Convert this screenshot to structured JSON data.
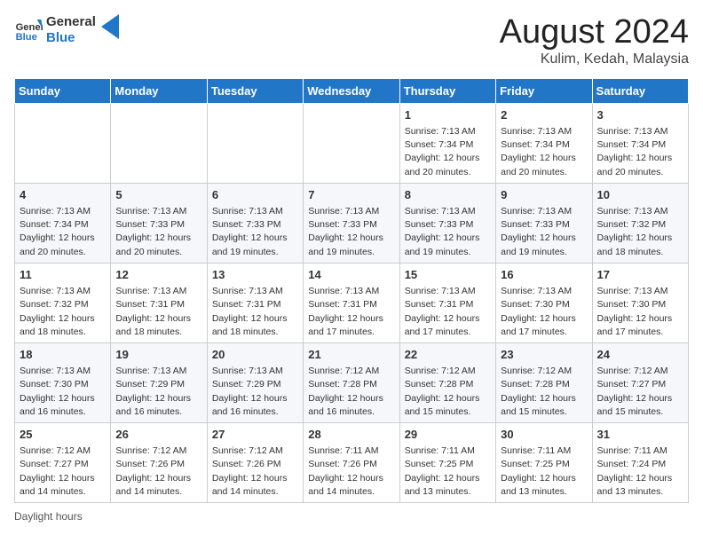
{
  "header": {
    "logo_line1": "General",
    "logo_line2": "Blue",
    "main_title": "August 2024",
    "subtitle": "Kulim, Kedah, Malaysia"
  },
  "columns": [
    "Sunday",
    "Monday",
    "Tuesday",
    "Wednesday",
    "Thursday",
    "Friday",
    "Saturday"
  ],
  "weeks": [
    [
      {
        "day": "",
        "info": ""
      },
      {
        "day": "",
        "info": ""
      },
      {
        "day": "",
        "info": ""
      },
      {
        "day": "",
        "info": ""
      },
      {
        "day": "1",
        "info": "Sunrise: 7:13 AM\nSunset: 7:34 PM\nDaylight: 12 hours\nand 20 minutes."
      },
      {
        "day": "2",
        "info": "Sunrise: 7:13 AM\nSunset: 7:34 PM\nDaylight: 12 hours\nand 20 minutes."
      },
      {
        "day": "3",
        "info": "Sunrise: 7:13 AM\nSunset: 7:34 PM\nDaylight: 12 hours\nand 20 minutes."
      }
    ],
    [
      {
        "day": "4",
        "info": "Sunrise: 7:13 AM\nSunset: 7:34 PM\nDaylight: 12 hours\nand 20 minutes."
      },
      {
        "day": "5",
        "info": "Sunrise: 7:13 AM\nSunset: 7:33 PM\nDaylight: 12 hours\nand 20 minutes."
      },
      {
        "day": "6",
        "info": "Sunrise: 7:13 AM\nSunset: 7:33 PM\nDaylight: 12 hours\nand 19 minutes."
      },
      {
        "day": "7",
        "info": "Sunrise: 7:13 AM\nSunset: 7:33 PM\nDaylight: 12 hours\nand 19 minutes."
      },
      {
        "day": "8",
        "info": "Sunrise: 7:13 AM\nSunset: 7:33 PM\nDaylight: 12 hours\nand 19 minutes."
      },
      {
        "day": "9",
        "info": "Sunrise: 7:13 AM\nSunset: 7:33 PM\nDaylight: 12 hours\nand 19 minutes."
      },
      {
        "day": "10",
        "info": "Sunrise: 7:13 AM\nSunset: 7:32 PM\nDaylight: 12 hours\nand 18 minutes."
      }
    ],
    [
      {
        "day": "11",
        "info": "Sunrise: 7:13 AM\nSunset: 7:32 PM\nDaylight: 12 hours\nand 18 minutes."
      },
      {
        "day": "12",
        "info": "Sunrise: 7:13 AM\nSunset: 7:31 PM\nDaylight: 12 hours\nand 18 minutes."
      },
      {
        "day": "13",
        "info": "Sunrise: 7:13 AM\nSunset: 7:31 PM\nDaylight: 12 hours\nand 18 minutes."
      },
      {
        "day": "14",
        "info": "Sunrise: 7:13 AM\nSunset: 7:31 PM\nDaylight: 12 hours\nand 17 minutes."
      },
      {
        "day": "15",
        "info": "Sunrise: 7:13 AM\nSunset: 7:31 PM\nDaylight: 12 hours\nand 17 minutes."
      },
      {
        "day": "16",
        "info": "Sunrise: 7:13 AM\nSunset: 7:30 PM\nDaylight: 12 hours\nand 17 minutes."
      },
      {
        "day": "17",
        "info": "Sunrise: 7:13 AM\nSunset: 7:30 PM\nDaylight: 12 hours\nand 17 minutes."
      }
    ],
    [
      {
        "day": "18",
        "info": "Sunrise: 7:13 AM\nSunset: 7:30 PM\nDaylight: 12 hours\nand 16 minutes."
      },
      {
        "day": "19",
        "info": "Sunrise: 7:13 AM\nSunset: 7:29 PM\nDaylight: 12 hours\nand 16 minutes."
      },
      {
        "day": "20",
        "info": "Sunrise: 7:13 AM\nSunset: 7:29 PM\nDaylight: 12 hours\nand 16 minutes."
      },
      {
        "day": "21",
        "info": "Sunrise: 7:12 AM\nSunset: 7:28 PM\nDaylight: 12 hours\nand 16 minutes."
      },
      {
        "day": "22",
        "info": "Sunrise: 7:12 AM\nSunset: 7:28 PM\nDaylight: 12 hours\nand 15 minutes."
      },
      {
        "day": "23",
        "info": "Sunrise: 7:12 AM\nSunset: 7:28 PM\nDaylight: 12 hours\nand 15 minutes."
      },
      {
        "day": "24",
        "info": "Sunrise: 7:12 AM\nSunset: 7:27 PM\nDaylight: 12 hours\nand 15 minutes."
      }
    ],
    [
      {
        "day": "25",
        "info": "Sunrise: 7:12 AM\nSunset: 7:27 PM\nDaylight: 12 hours\nand 14 minutes."
      },
      {
        "day": "26",
        "info": "Sunrise: 7:12 AM\nSunset: 7:26 PM\nDaylight: 12 hours\nand 14 minutes."
      },
      {
        "day": "27",
        "info": "Sunrise: 7:12 AM\nSunset: 7:26 PM\nDaylight: 12 hours\nand 14 minutes."
      },
      {
        "day": "28",
        "info": "Sunrise: 7:11 AM\nSunset: 7:26 PM\nDaylight: 12 hours\nand 14 minutes."
      },
      {
        "day": "29",
        "info": "Sunrise: 7:11 AM\nSunset: 7:25 PM\nDaylight: 12 hours\nand 13 minutes."
      },
      {
        "day": "30",
        "info": "Sunrise: 7:11 AM\nSunset: 7:25 PM\nDaylight: 12 hours\nand 13 minutes."
      },
      {
        "day": "31",
        "info": "Sunrise: 7:11 AM\nSunset: 7:24 PM\nDaylight: 12 hours\nand 13 minutes."
      }
    ]
  ],
  "footer": {
    "daylight_label": "Daylight hours"
  }
}
